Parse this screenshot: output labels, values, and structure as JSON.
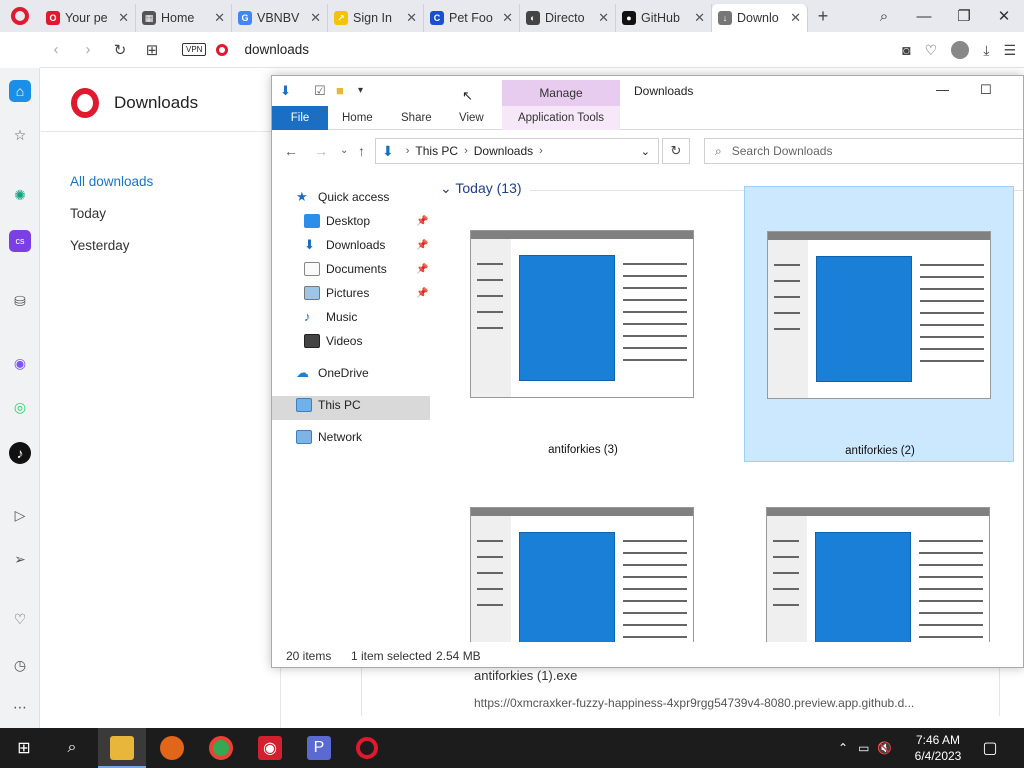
{
  "browser": {
    "tabs": [
      {
        "label": "Your pe",
        "favicon_color": "#e0192e",
        "favicon": "O"
      },
      {
        "label": "Home",
        "favicon_color": "#555555",
        "favicon": "▦"
      },
      {
        "label": "VBNBV",
        "favicon_color": "#4285f4",
        "favicon": "G"
      },
      {
        "label": "Sign In",
        "favicon_color": "#f4c20d",
        "favicon": "↗"
      },
      {
        "label": "Pet Foo",
        "favicon_color": "#1a4fd0",
        "favicon": "C"
      },
      {
        "label": "Directo",
        "favicon_color": "#444444",
        "favicon": "◐"
      },
      {
        "label": "GitHub",
        "favicon_color": "#111111",
        "favicon": "●"
      },
      {
        "label": "Downlo",
        "favicon_color": "#777777",
        "favicon": "↓"
      }
    ],
    "address": "downloads",
    "vpn_label": "VPN"
  },
  "downloads_page": {
    "title": "Downloads",
    "nav": [
      "All downloads",
      "Today",
      "Yesterday"
    ],
    "item_name": "antiforkies (1).exe",
    "item_url": "https://0xmcraxker-fuzzy-happiness-4xpr9rgg54739v4-8080.preview.app.github.d..."
  },
  "explorer": {
    "window_title": "Downloads",
    "manage_label": "Manage",
    "ribbon_tabs": [
      "File",
      "Home",
      "Share",
      "View",
      "Application Tools"
    ],
    "path": [
      "This PC",
      "Downloads"
    ],
    "search_placeholder": "Search Downloads",
    "nav_items": {
      "quick_access": "Quick access",
      "desktop": "Desktop",
      "downloads": "Downloads",
      "documents": "Documents",
      "pictures": "Pictures",
      "music": "Music",
      "videos": "Videos",
      "onedrive": "OneDrive",
      "this_pc": "This PC",
      "network": "Network"
    },
    "group_header": "Today (13)",
    "files": [
      {
        "name": "antiforkies (3)",
        "selected": false
      },
      {
        "name": "antiforkies (2)",
        "selected": true
      },
      {
        "name": "",
        "selected": false
      },
      {
        "name": "",
        "selected": false
      }
    ],
    "status": {
      "count": "20 items",
      "selection": "1 item selected",
      "size": "2.54 MB"
    }
  },
  "taskbar": {
    "time": "7:46 AM",
    "date": "6/4/2023"
  }
}
